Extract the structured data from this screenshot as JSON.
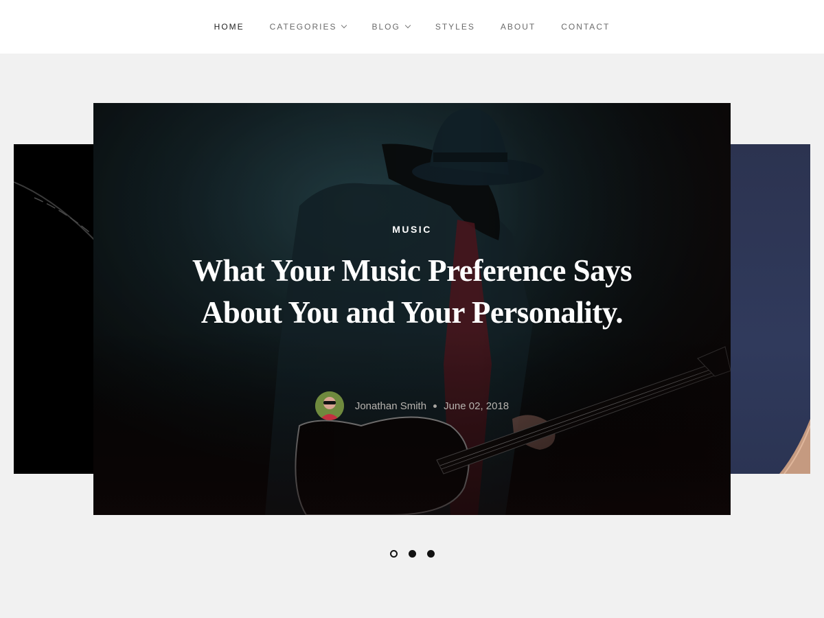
{
  "nav": {
    "items": [
      {
        "label": "HOME",
        "active": true,
        "dropdown": false
      },
      {
        "label": "CATEGORIES",
        "active": false,
        "dropdown": true
      },
      {
        "label": "BLOG",
        "active": false,
        "dropdown": true
      },
      {
        "label": "STYLES",
        "active": false,
        "dropdown": false
      },
      {
        "label": "ABOUT",
        "active": false,
        "dropdown": false
      },
      {
        "label": "CONTACT",
        "active": false,
        "dropdown": false
      }
    ]
  },
  "featured": {
    "category": "MUSIC",
    "title": "What Your Music Preference Says About You and Your Personality.",
    "author": "Jonathan Smith",
    "date": "June 02, 2018",
    "image_subject": "guitarist-in-hat-on-dark-stage"
  },
  "slider": {
    "slide_count": 3,
    "active_index": 0
  },
  "colors": {
    "page_bg": "#f1f1f1",
    "header_bg": "#ffffff",
    "nav_text": "#6a6a6a",
    "nav_active": "#222222",
    "overlay_text": "#ffffff",
    "meta_text": "#b7b3af"
  }
}
